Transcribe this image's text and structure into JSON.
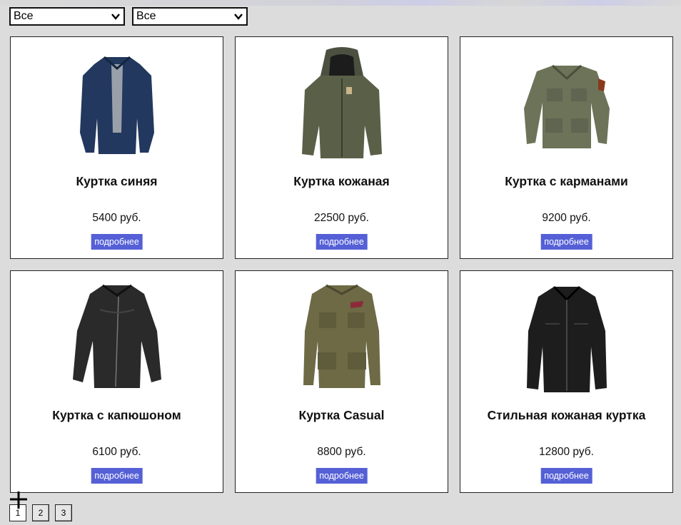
{
  "filters": [
    {
      "value": "Все",
      "icon": "chevron-down-icon"
    },
    {
      "value": "Все",
      "icon": "chevron-down-icon"
    }
  ],
  "products": [
    {
      "title": "Куртка синяя",
      "price": "5400 руб.",
      "button": "подробнее",
      "image": "navy-jacket",
      "color": "#22385e"
    },
    {
      "title": "Куртка кожаная",
      "price": "22500 руб.",
      "button": "подробнее",
      "image": "olive-hooded-jacket",
      "color": "#5a6048"
    },
    {
      "title": "Куртка с карманами",
      "price": "9200 руб.",
      "button": "подробнее",
      "image": "olive-field-shirt",
      "color": "#6c7358"
    },
    {
      "title": "Куртка с капюшоном",
      "price": "6100 руб.",
      "button": "подробнее",
      "image": "black-leather-moto-jacket",
      "color": "#2a2a2a"
    },
    {
      "title": "Куртка Casual",
      "price": "8800 руб.",
      "button": "подробнее",
      "image": "khaki-field-jacket",
      "color": "#6d6a45"
    },
    {
      "title": "Стильная кожаная куртка",
      "price": "12800 руб.",
      "button": "подробнее",
      "image": "black-leather-jacket",
      "color": "#1d1d1d"
    }
  ],
  "pagination": {
    "pages": [
      "1",
      "2",
      "3"
    ],
    "current": "1"
  },
  "colors": {
    "button": "#5560d6",
    "background": "#dcdcdc"
  }
}
